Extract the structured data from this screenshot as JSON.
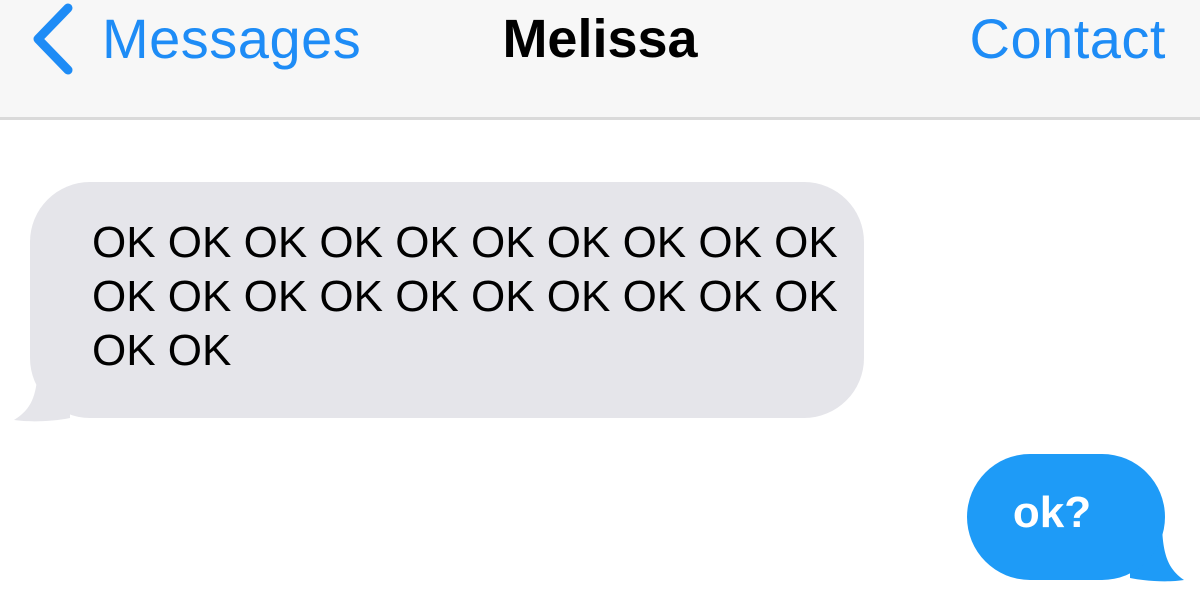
{
  "navbar": {
    "back_label": "Messages",
    "title": "Melissa",
    "contact_label": "Contact"
  },
  "thread": {
    "messages": [
      {
        "direction": "received",
        "text": "OK OK OK OK OK OK OK OK OK OK OK OK OK OK OK OK OK OK OK OK OK OK"
      },
      {
        "direction": "sent",
        "text": "ok?"
      }
    ]
  },
  "colors": {
    "accent": "#1e8cf6",
    "sent_bubble": "#1e9bf7",
    "received_bubble": "#e5e5ea",
    "navbar_background": "#f7f7f7",
    "navbar_border": "#dadada"
  },
  "icons": {
    "back": "chevron-left-icon"
  }
}
